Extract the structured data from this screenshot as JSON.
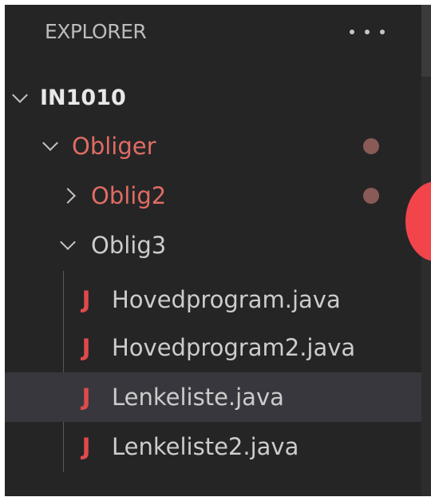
{
  "explorer": {
    "title": "EXPLORER",
    "more_icon": "ellipsis-icon"
  },
  "tree": {
    "root": {
      "label": "IN1010",
      "expanded": true
    },
    "obliger": {
      "label": "Obliger",
      "expanded": true,
      "modified": true
    },
    "oblig2": {
      "label": "Oblig2",
      "expanded": false,
      "modified": true
    },
    "oblig3": {
      "label": "Oblig3",
      "expanded": true
    },
    "files": [
      {
        "icon": "J",
        "name": "Hovedprogram.java",
        "selected": false
      },
      {
        "icon": "J",
        "name": "Hovedprogram2.java",
        "selected": false
      },
      {
        "icon": "J",
        "name": "Lenkeliste.java",
        "selected": true
      },
      {
        "icon": "J",
        "name": "Lenkeliste2.java",
        "selected": false
      }
    ]
  },
  "colors": {
    "background": "#252526",
    "selected_row": "#37373d",
    "modified_text": "#e06c63",
    "modified_dot": "#8a5a57",
    "java_icon": "#e04a4a",
    "overlay_circle": "#f1454b"
  }
}
